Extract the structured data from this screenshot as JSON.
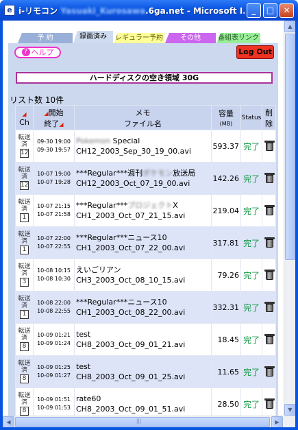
{
  "window": {
    "title_prefix": "i-リモコン",
    "title_blurred": "Yasuaki_Kurosawa",
    "title_suffix": ".6ga.net - Microsoft I...",
    "app_icon": "ie-page-icon",
    "min_glyph": "_",
    "max_glyph": "□",
    "close_glyph": "✕"
  },
  "tabs": [
    {
      "label": "予 約"
    },
    {
      "label": "録画済み"
    },
    {
      "label": "レギュラー予約"
    },
    {
      "label": "その他"
    },
    {
      "label": "番組表リンク"
    }
  ],
  "header": {
    "help_icon": "?",
    "help_label": "ヘルプ",
    "logout_label": "Log Out",
    "disk_label": "ハードディスクの空き領域 30G"
  },
  "list": {
    "count_label": "リスト数 10件",
    "headers": {
      "arrow": "◢",
      "ch": "Ch",
      "start": "開始",
      "end": "終了",
      "memo": "メモ",
      "filename": "ファイル名",
      "size": "容量",
      "size_unit": "(MB)",
      "status": "Status",
      "delete": "削除"
    },
    "rows": [
      {
        "tag1": "転送",
        "tag2": "済",
        "ch": "12",
        "start": "09-30 19:00",
        "end": "09-30 19:57",
        "memo_blur": "Pokemon",
        "memo": " Special",
        "file": "CH12_2003_Sep_30_19_00.avi",
        "size": "593.37",
        "status": "完了"
      },
      {
        "tag1": "転送",
        "tag2": "済",
        "ch": "12",
        "start": "10-07 19:00",
        "end": "10-07 19:28",
        "memo_pre": "***Regular***週刊",
        "memo_blur": "ポケモン",
        "memo": "放送局",
        "file": "CH12_2003_Oct_07_19_00.avi",
        "size": "142.26",
        "status": "完了"
      },
      {
        "tag1": "転送",
        "tag2": "済",
        "ch": "1",
        "start": "10-07 21:15",
        "end": "10-07 21:58",
        "memo_pre": "***Regular***",
        "memo_blur": "プロジェクト",
        "memo": "X",
        "file": "CH1_2003_Oct_07_21_15.avi",
        "size": "219.04",
        "status": "完了"
      },
      {
        "tag1": "転送",
        "tag2": "済",
        "ch": "1",
        "start": "10-07 22:00",
        "end": "10-07 22:55",
        "memo": "***Regular***ニュース10",
        "file": "CH1_2003_Oct_07_22_00.avi",
        "size": "317.81",
        "status": "完了"
      },
      {
        "tag1": "転送",
        "tag2": "済",
        "ch": "3",
        "start": "10-08 10:15",
        "end": "10-08 10:30",
        "memo": "えいごリアン",
        "file": "CH3_2003_Oct_08_10_15.avi",
        "size": "79.26",
        "status": "完了"
      },
      {
        "tag1": "転送",
        "tag2": "済",
        "ch": "1",
        "start": "10-08 22:00",
        "end": "10-08 22:55",
        "memo": "***Regular***ニュース10",
        "file": "CH1_2003_Oct_08_22_00.avi",
        "size": "332.31",
        "status": "完了"
      },
      {
        "tag1": "転送",
        "tag2": "済",
        "ch": "8",
        "start": "10-09 01:21",
        "end": "10-09 01:24",
        "memo": "test",
        "file": "CH8_2003_Oct_09_01_21.avi",
        "size": "18.45",
        "status": "完了"
      },
      {
        "tag1": "転送",
        "tag2": "済",
        "ch": "8",
        "start": "10-09 01:25",
        "end": "10-09 01:27",
        "memo": "test",
        "file": "CH8_2003_Oct_09_01_25.avi",
        "size": "11.65",
        "status": "完了"
      },
      {
        "tag1": "転送",
        "tag2": "済",
        "ch": "8",
        "start": "10-09 01:51",
        "end": "10-09 01:53",
        "memo": "rate60",
        "file": "CH8_2003_Oct_09_01_51.avi",
        "size": "28.50",
        "status": "完了"
      }
    ]
  },
  "scroll": {
    "up": "▲",
    "down": "▼",
    "left": "◀",
    "right": "▶",
    "grip": "|||"
  }
}
